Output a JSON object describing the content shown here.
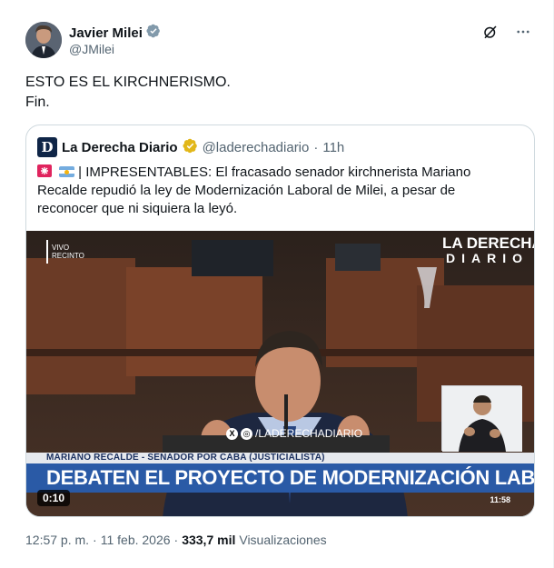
{
  "author": {
    "name": "Javier Milei",
    "handle": "@JMilei",
    "verified_badge": "grey-verified-icon"
  },
  "tweet": {
    "text_line1": "ESTO ES EL KIRCHNERISMO.",
    "text_line2": "Fin."
  },
  "quoted": {
    "name": "La Derecha Diario",
    "handle": "@laderechadiario",
    "separator": "·",
    "time_ago": "11h",
    "logo_letter": "D",
    "text": "| IMPRESENTABLES: El fracasado senador kirchnerista Mariano Recalde repudió la ley de Modernización Laboral de Milei, a pesar de reconocer que ni siquiera la leyó.",
    "media": {
      "brand_line1": "LA DERECHA",
      "brand_line2": "DIARIO",
      "live_tag_line1": "VIVO",
      "live_tag_line2": "RECINTO",
      "social_handle": "/LADERECHADIARIO",
      "lower_band": "MARIANO RECALDE - SENADOR POR CABA (JUSTICIALISTA)",
      "lower_title": "DEBATEN EL PROYECTO DE MODERNIZACIÓN LABORAL",
      "duration": "0:10",
      "clock": "11:58"
    }
  },
  "meta": {
    "time": "12:57 p. m.",
    "separator": "·",
    "date": "11 feb. 2026",
    "views_count": "333,7 mil",
    "views_label": "Visualizaciones"
  },
  "colors": {
    "text_primary": "#0f1419",
    "text_secondary": "#536471",
    "border": "#cfd9de",
    "verified_gold": "#e2b719",
    "verified_grey": "#829aab",
    "banner_blue": "#2a5aa6"
  }
}
